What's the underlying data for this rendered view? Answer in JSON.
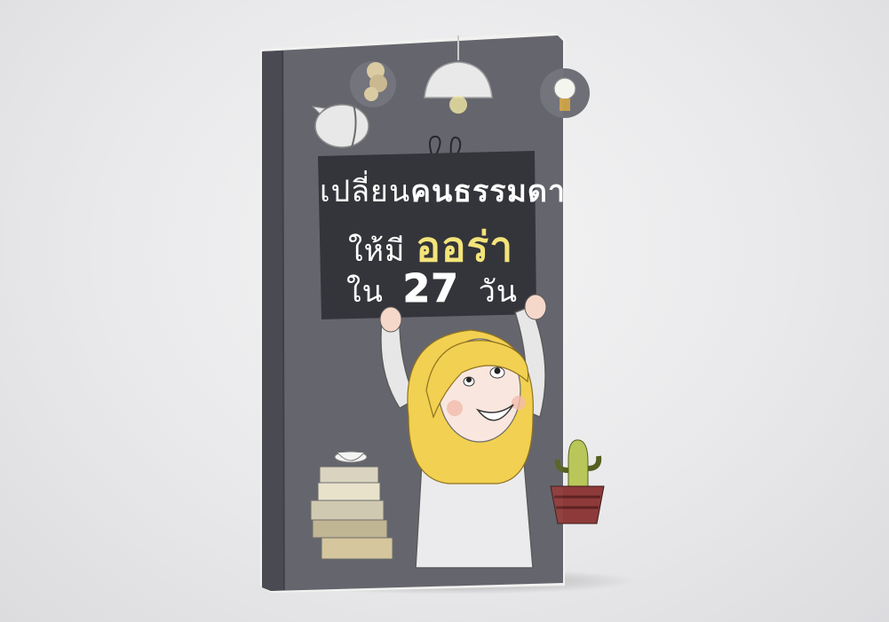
{
  "book": {
    "title_line1_thin": "เปลี่ยน",
    "title_line1_bold": "คนธรรมดา",
    "title_line2_prefix": "ให้มี",
    "title_line2_highlight": "ออร่า",
    "title_line3_prefix": "ใน",
    "title_line3_number": "27",
    "title_line3_suffix": "วัน"
  },
  "colors": {
    "background": "#e9e9eb",
    "cover": "#5f6068",
    "spine": "#4a4b52",
    "banner": "#2c2d32",
    "highlight": "#f3e47a",
    "hair": "#f2cf4a"
  }
}
